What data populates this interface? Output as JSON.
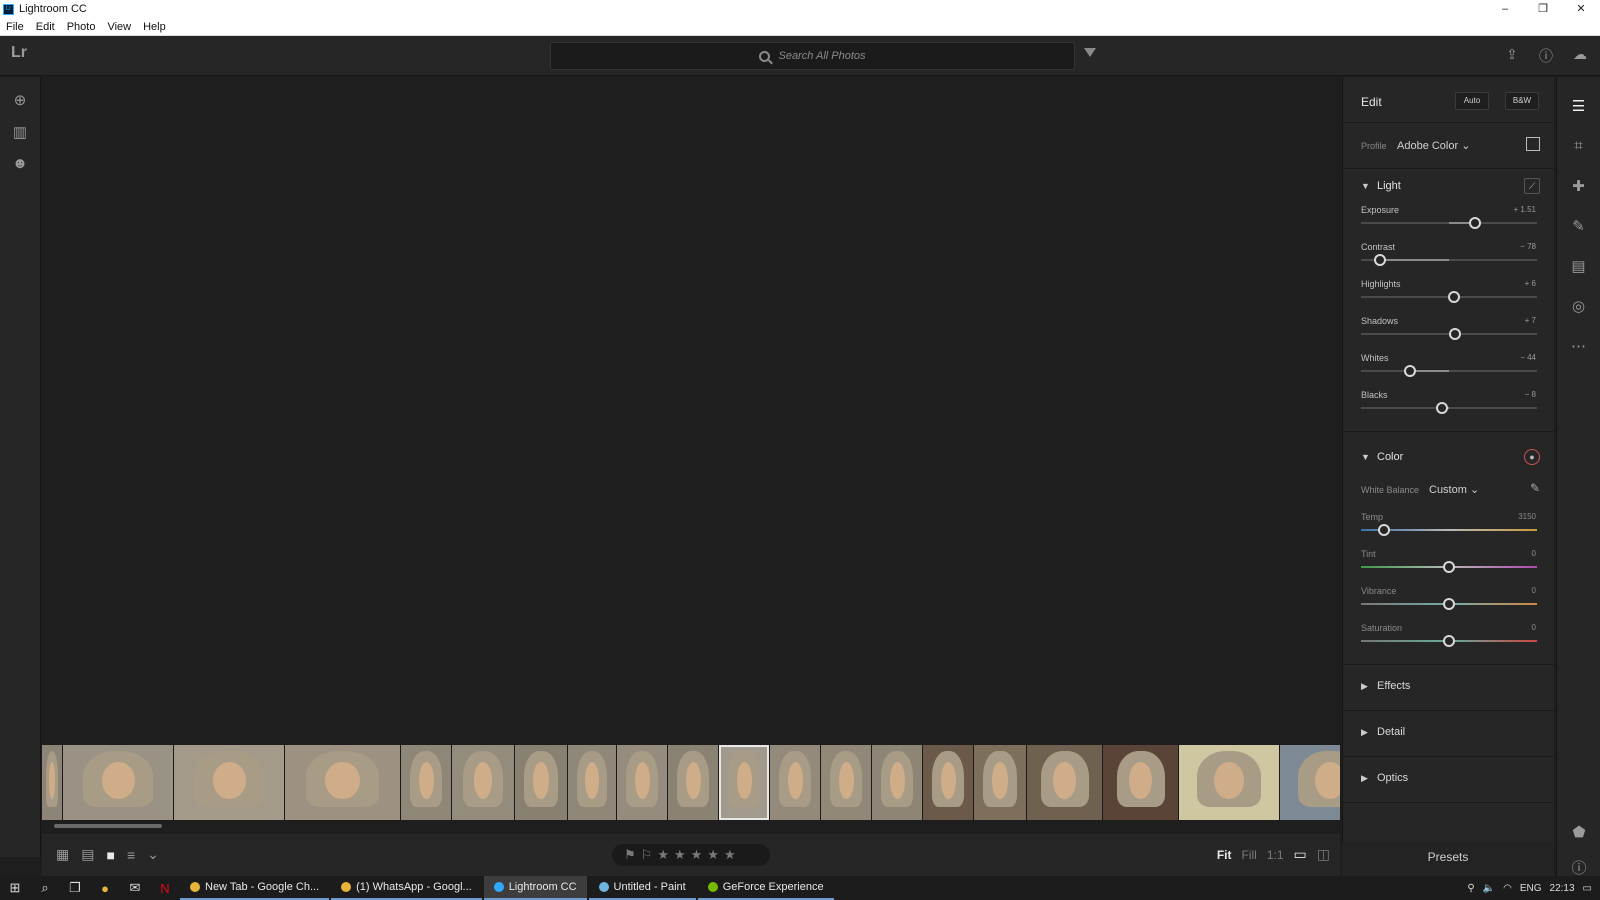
{
  "window": {
    "title": "Lightroom CC",
    "app_badge": "Lr",
    "min": "–",
    "max": "❐",
    "close": "✕"
  },
  "menu": [
    "File",
    "Edit",
    "Photo",
    "View",
    "Help"
  ],
  "topbar": {
    "logo": "Lr",
    "search_placeholder": "Search All Photos",
    "icons": [
      "share-icon",
      "help-icon",
      "cloud-icon"
    ]
  },
  "left_rail": [
    "add-photos-icon",
    "library-icon",
    "people-icon"
  ],
  "edit_panel": {
    "title": "Edit",
    "auto_label": "Auto",
    "bw_label": "B&W",
    "profile_label": "Profile",
    "profile_value": "Adobe Color",
    "light": {
      "label": "Light",
      "sliders": [
        {
          "label": "Exposure",
          "value": "+ 1.51",
          "pos": 0.65
        },
        {
          "label": "Contrast",
          "value": "− 78",
          "pos": 0.11
        },
        {
          "label": "Highlights",
          "value": "+ 6",
          "pos": 0.53
        },
        {
          "label": "Shadows",
          "value": "+ 7",
          "pos": 0.535
        },
        {
          "label": "Whites",
          "value": "− 44",
          "pos": 0.28
        },
        {
          "label": "Blacks",
          "value": "− 8",
          "pos": 0.46
        }
      ]
    },
    "color": {
      "label": "Color",
      "wb_label": "White Balance",
      "wb_value": "Custom",
      "sliders": [
        {
          "label": "Temp",
          "value": "3150",
          "pos": 0.13
        },
        {
          "label": "Tint",
          "value": "0",
          "pos": 0.5
        },
        {
          "label": "Vibrance",
          "value": "0",
          "pos": 0.5
        },
        {
          "label": "Saturation",
          "value": "0",
          "pos": 0.5
        }
      ]
    },
    "collapsed_sections": [
      "Effects",
      "Detail",
      "Optics"
    ],
    "presets_label": "Presets"
  },
  "bottombar": {
    "fit": "Fit",
    "fill": "Fill",
    "one_to_one": "1:1"
  },
  "filmstrip": {
    "selected_index": 10,
    "thumbs": [
      {
        "bg": "#8c8476"
      },
      {
        "bg": "#9a9284"
      },
      {
        "bg": "#a39a8a"
      },
      {
        "bg": "#9d9282"
      },
      {
        "bg": "#8e8676"
      },
      {
        "bg": "#938b7c"
      },
      {
        "bg": "#888070"
      },
      {
        "bg": "#8f8777"
      },
      {
        "bg": "#958c7d"
      },
      {
        "bg": "#8a8272"
      },
      {
        "bg": "#a29a8c"
      },
      {
        "bg": "#938a7b"
      },
      {
        "bg": "#918878"
      },
      {
        "bg": "#8d8575"
      },
      {
        "bg": "#6b5a4a"
      },
      {
        "bg": "#7e6f5c"
      },
      {
        "bg": "#6f6050"
      },
      {
        "bg": "#5a4438"
      },
      {
        "bg": "#cfc6a2"
      },
      {
        "bg": "#7d8a96"
      },
      {
        "bg": "#b3a99a"
      }
    ]
  },
  "taskbar": {
    "apps": [
      {
        "label": "New Tab - Google Ch...",
        "color": "#e8b33a"
      },
      {
        "label": "(1) WhatsApp - Googl...",
        "color": "#e8b33a"
      },
      {
        "label": "Lightroom CC",
        "color": "#31a8ff"
      },
      {
        "label": "Untitled - Paint",
        "color": "#6fb3e0"
      },
      {
        "label": "GeForce Experience",
        "color": "#76b900"
      }
    ],
    "lang": "ENG",
    "time": "22:13"
  }
}
